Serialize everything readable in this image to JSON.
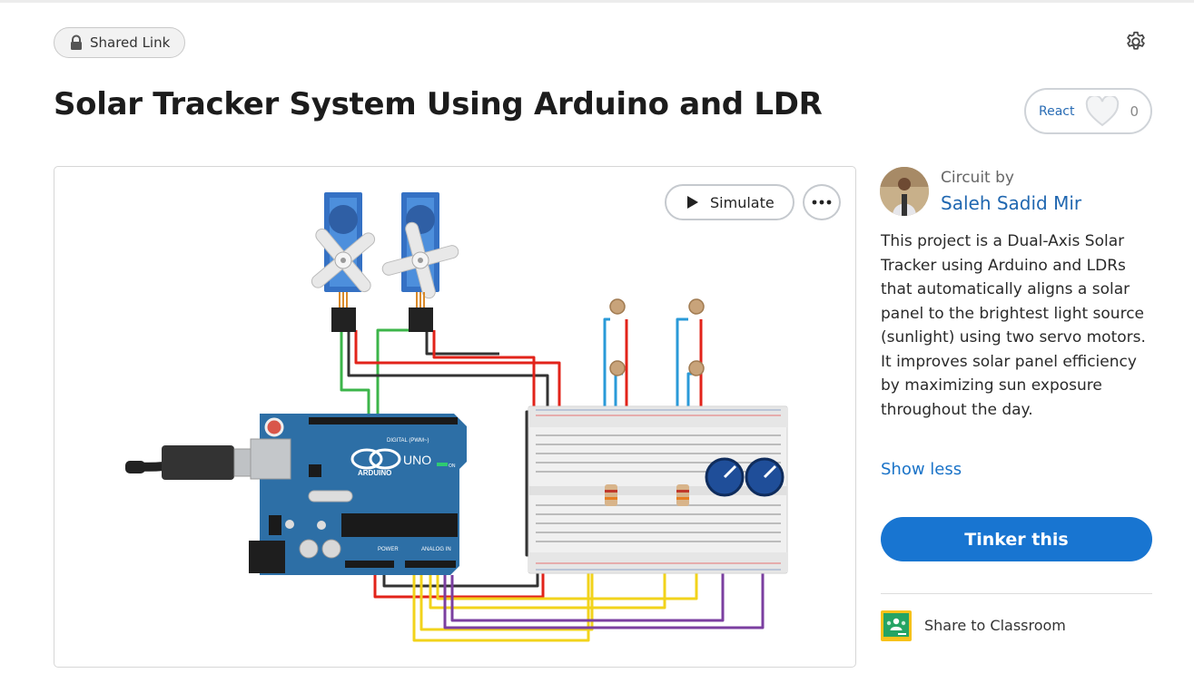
{
  "header": {
    "shared_link_label": "Shared Link",
    "settings_icon": "gear-icon",
    "lock_icon": "lock-icon"
  },
  "project": {
    "title": "Solar Tracker System Using Arduino and LDR",
    "react_label": "React",
    "react_count": "0"
  },
  "viewer": {
    "simulate_label": "Simulate",
    "more_icon": "more-icon",
    "board_labels": {
      "uno": "UNO",
      "arduino": "ARDUINO",
      "digital": "DIGITAL (PWM~)",
      "power": "POWER",
      "analog": "ANALOG IN",
      "on": "ON"
    }
  },
  "author": {
    "circuit_by": "Circuit by",
    "name": "Saleh Sadid Mir"
  },
  "description": "This project is a Dual-Axis Solar Tracker using Arduino and LDRs that automatically aligns a solar panel to the brightest light source (sunlight) using two servo motors. It improves solar panel efficiency by maximizing sun exposure throughout the day.",
  "actions": {
    "show_less": "Show less",
    "tinker": "Tinker this",
    "share_classroom": "Share to Classroom"
  },
  "colors": {
    "accent_blue": "#1875d1",
    "link_blue": "#2067b0",
    "board_blue": "#2d6fa6",
    "wire_red": "#e2231a",
    "wire_yellow": "#f2d31b",
    "wire_purple": "#7b3fa0",
    "wire_green": "#3cb54a",
    "wire_black": "#333333",
    "wire_blue": "#2a9ad8"
  }
}
